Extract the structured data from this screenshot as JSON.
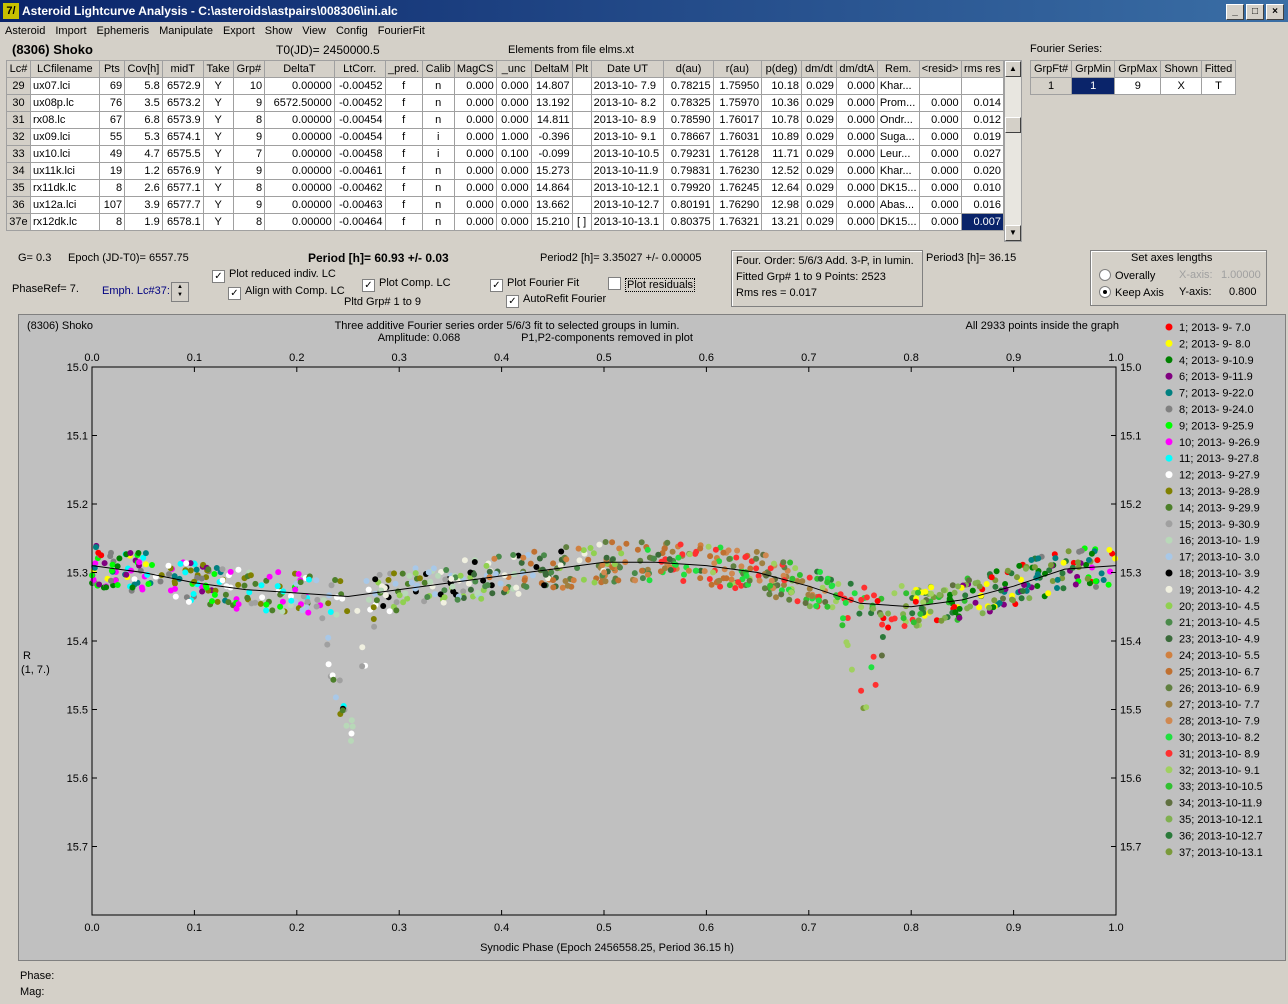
{
  "window": {
    "title": "Asteroid Lightcurve Analysis - C:\\asteroids\\astpairs\\008306\\ini.alc",
    "icon_glyph": "7/",
    "buttons": [
      "_",
      "□",
      "×"
    ]
  },
  "menu": [
    "Asteroid",
    "Import",
    "Ephemeris",
    "Manipulate",
    "Export",
    "Show",
    "View",
    "Config",
    "FourierFit"
  ],
  "header": {
    "asteroid": "(8306) Shoko",
    "t0": "T0(JD)= 2450000.5",
    "elements": "Elements from file elms.xt",
    "fourier_label": "Fourier Series:"
  },
  "lc_table": {
    "columns": [
      "Lc#",
      "LCfilename",
      "Pts",
      "Cov[h]",
      "midT",
      "Take",
      "Grp#",
      "DeltaT",
      "LtCorr.",
      "_pred.",
      "Calib",
      "MagCS",
      "_unc",
      "DeltaM",
      "Plt",
      "Date UT",
      "d(au)",
      "r(au)",
      "p(deg)",
      "dm/dt",
      "dm/dtA",
      "Rem.",
      "<resid>",
      "rms res"
    ],
    "rows": [
      [
        "29",
        "ux07.lci",
        "69",
        "5.8",
        "6572.9",
        "Y",
        "10",
        "0.00000",
        "-0.00452",
        "f",
        "n",
        "0.000",
        "0.000",
        "14.807",
        "",
        "2013-10- 7.9",
        "0.78215",
        "1.75950",
        "10.18",
        "0.029",
        "0.000",
        "Khar...",
        "",
        ""
      ],
      [
        "30",
        "ux08p.lc",
        "76",
        "3.5",
        "6573.2",
        "Y",
        "9",
        "6572.50000",
        "-0.00452",
        "f",
        "n",
        "0.000",
        "0.000",
        "13.192",
        "",
        "2013-10- 8.2",
        "0.78325",
        "1.75970",
        "10.36",
        "0.029",
        "0.000",
        "Prom...",
        "0.000",
        "0.014"
      ],
      [
        "31",
        "rx08.lc",
        "67",
        "6.8",
        "6573.9",
        "Y",
        "8",
        "0.00000",
        "-0.00454",
        "f",
        "n",
        "0.000",
        "0.000",
        "14.811",
        "",
        "2013-10- 8.9",
        "0.78590",
        "1.76017",
        "10.78",
        "0.029",
        "0.000",
        "Ondr...",
        "0.000",
        "0.012"
      ],
      [
        "32",
        "ux09.lci",
        "55",
        "5.3",
        "6574.1",
        "Y",
        "9",
        "0.00000",
        "-0.00454",
        "f",
        "i",
        "0.000",
        "1.000",
        "-0.396",
        "",
        "2013-10- 9.1",
        "0.78667",
        "1.76031",
        "10.89",
        "0.029",
        "0.000",
        "Suga...",
        "0.000",
        "0.019"
      ],
      [
        "33",
        "ux10.lci",
        "49",
        "4.7",
        "6575.5",
        "Y",
        "7",
        "0.00000",
        "-0.00458",
        "f",
        "i",
        "0.000",
        "0.100",
        "-0.099",
        "",
        "2013-10-10.5",
        "0.79231",
        "1.76128",
        "11.71",
        "0.029",
        "0.000",
        "Leur...",
        "0.000",
        "0.027"
      ],
      [
        "34",
        "ux11k.lci",
        "19",
        "1.2",
        "6576.9",
        "Y",
        "9",
        "0.00000",
        "-0.00461",
        "f",
        "n",
        "0.000",
        "0.000",
        "15.273",
        "",
        "2013-10-11.9",
        "0.79831",
        "1.76230",
        "12.52",
        "0.029",
        "0.000",
        "Khar...",
        "0.000",
        "0.020"
      ],
      [
        "35",
        "rx11dk.lc",
        "8",
        "2.6",
        "6577.1",
        "Y",
        "8",
        "0.00000",
        "-0.00462",
        "f",
        "n",
        "0.000",
        "0.000",
        "14.864",
        "",
        "2013-10-12.1",
        "0.79920",
        "1.76245",
        "12.64",
        "0.029",
        "0.000",
        "DK15...",
        "0.000",
        "0.010"
      ],
      [
        "36",
        "ux12a.lci",
        "107",
        "3.9",
        "6577.7",
        "Y",
        "9",
        "0.00000",
        "-0.00463",
        "f",
        "n",
        "0.000",
        "0.000",
        "13.662",
        "",
        "2013-10-12.7",
        "0.80191",
        "1.76290",
        "12.98",
        "0.029",
        "0.000",
        "Abas...",
        "0.000",
        "0.016"
      ],
      [
        "37e",
        "rx12dk.lc",
        "8",
        "1.9",
        "6578.1",
        "Y",
        "8",
        "0.00000",
        "-0.00464",
        "f",
        "n",
        "0.000",
        "0.000",
        "15.210",
        "[ ]",
        "2013-10-13.1",
        "0.80375",
        "1.76321",
        "13.21",
        "0.029",
        "0.000",
        "DK15...",
        "0.000",
        "0.007"
      ]
    ]
  },
  "fourier_table": {
    "columns": [
      "GrpFt#",
      "GrpMin",
      "GrpMax",
      "Shown",
      "Fitted"
    ],
    "row": [
      "1",
      "1",
      "9",
      "X",
      "T"
    ]
  },
  "params": {
    "g": "G= 0.3",
    "epoch": "Epoch (JD-T0)= 6557.75",
    "period": "Period [h]= 60.93 +/- 0.03",
    "period2": "Period2 [h]= 3.35027 +/- 0.00005",
    "period3": "Period3 [h]= 36.15",
    "phaseref": "PhaseRef= 7.",
    "emph": "Emph. Lc#37:",
    "cb_reduced": "Plot reduced indiv. LC",
    "cb_align": "Align with Comp. LC",
    "cb_comp": "Plot Comp. LC",
    "pltd": "Pltd Grp#  1   to   9",
    "cb_fourier": "Plot Fourier Fit",
    "cb_autorefit": "AutoRefit Fourier",
    "cb_residuals": "Plot residuals",
    "four_order": "Four. Order:  5/6/3   Add. 3-P, in lumin.",
    "fitted_grp": "Fitted Grp# 1 to 9     Points: 2523",
    "rms": "Rms res     = 0.017",
    "axes_title": "Set axes lengths",
    "overally": "Overally",
    "keep_axis": "Keep Axis",
    "xaxis_label": "X-axis:",
    "xaxis_val": "1.00000",
    "yaxis_label": "Y-axis:",
    "yaxis_val": "0.800"
  },
  "chart_data": {
    "type": "scatter",
    "title": "Three additive Fourier series order 5/6/3 fit to selected groups in lumin.",
    "subtitle": "Amplitude: 0.068",
    "subtitle2": "P1,P2-components removed in plot",
    "corner_left": "(8306) Shoko",
    "corner_right": "All 2933 points inside the graph",
    "xlabel": "Synodic Phase (Epoch 2456558.25, Period 36.15 h)",
    "ylabel": "R",
    "ylabel2": "(1, 7.)",
    "xlim": [
      0.0,
      1.0
    ],
    "ylim": [
      15.0,
      15.8
    ],
    "y_inverted": true,
    "x_ticks": [
      "0.0",
      "0.1",
      "0.2",
      "0.3",
      "0.4",
      "0.5",
      "0.6",
      "0.7",
      "0.8",
      "0.9",
      "1.0"
    ],
    "y_ticks": [
      "15.0",
      "15.1",
      "15.2",
      "15.3",
      "15.4",
      "15.5",
      "15.6",
      "15.7"
    ],
    "fourier_curve": [
      [
        0.0,
        15.29
      ],
      [
        0.05,
        15.3
      ],
      [
        0.1,
        15.315
      ],
      [
        0.15,
        15.325
      ],
      [
        0.2,
        15.33
      ],
      [
        0.25,
        15.335
      ],
      [
        0.3,
        15.325
      ],
      [
        0.35,
        15.315
      ],
      [
        0.4,
        15.305
      ],
      [
        0.45,
        15.295
      ],
      [
        0.5,
        15.285
      ],
      [
        0.55,
        15.285
      ],
      [
        0.6,
        15.29
      ],
      [
        0.65,
        15.3
      ],
      [
        0.7,
        15.32
      ],
      [
        0.75,
        15.345
      ],
      [
        0.8,
        15.35
      ],
      [
        0.85,
        15.34
      ],
      [
        0.9,
        15.32
      ],
      [
        0.95,
        15.295
      ],
      [
        1.0,
        15.29
      ]
    ],
    "legend": [
      {
        "label": "1; 2013- 9- 7.0",
        "color": "#ff0000"
      },
      {
        "label": "2; 2013- 9- 8.0",
        "color": "#ffff00"
      },
      {
        "label": "4; 2013- 9-10.9",
        "color": "#008000"
      },
      {
        "label": "6; 2013- 9-11.9",
        "color": "#800080"
      },
      {
        "label": "7; 2013- 9-22.0",
        "color": "#008080"
      },
      {
        "label": "8; 2013- 9-24.0",
        "color": "#808080"
      },
      {
        "label": "9; 2013- 9-25.9",
        "color": "#00ff00"
      },
      {
        "label": "10; 2013- 9-26.9",
        "color": "#ff00ff"
      },
      {
        "label": "11; 2013- 9-27.8",
        "color": "#00ffff"
      },
      {
        "label": "12; 2013- 9-27.9",
        "color": "#ffffff"
      },
      {
        "label": "13; 2013- 9-28.9",
        "color": "#808000"
      },
      {
        "label": "14; 2013- 9-29.9",
        "color": "#4c7f2a"
      },
      {
        "label": "15; 2013- 9-30.9",
        "color": "#a0a0a0"
      },
      {
        "label": "16; 2013-10- 1.9",
        "color": "#b8d8b8"
      },
      {
        "label": "17; 2013-10- 3.0",
        "color": "#a8c8e8"
      },
      {
        "label": "18; 2013-10- 3.9",
        "color": "#000000"
      },
      {
        "label": "19; 2013-10- 4.2",
        "color": "#f0f0e0"
      },
      {
        "label": "20; 2013-10- 4.5",
        "color": "#90d050"
      },
      {
        "label": "21; 2013-10- 4.5",
        "color": "#4a8a4a"
      },
      {
        "label": "23; 2013-10- 4.9",
        "color": "#3a6a3a"
      },
      {
        "label": "24; 2013-10- 5.5",
        "color": "#d08040"
      },
      {
        "label": "25; 2013-10- 6.7",
        "color": "#c07030"
      },
      {
        "label": "26; 2013-10- 6.9",
        "color": "#608040"
      },
      {
        "label": "27; 2013-10- 7.7",
        "color": "#a08040"
      },
      {
        "label": "28; 2013-10- 7.9",
        "color": "#d08850"
      },
      {
        "label": "30; 2013-10- 8.2",
        "color": "#20e040"
      },
      {
        "label": "31; 2013-10- 8.9",
        "color": "#ff3030"
      },
      {
        "label": "32; 2013-10- 9.1",
        "color": "#a0d060"
      },
      {
        "label": "33; 2013-10-10.5",
        "color": "#30c030"
      },
      {
        "label": "34; 2013-10-11.9",
        "color": "#607040"
      },
      {
        "label": "35; 2013-10-12.1",
        "color": "#80b050"
      },
      {
        "label": "36; 2013-10-12.7",
        "color": "#2a7a3a"
      },
      {
        "label": "37; 2013-10-13.1",
        "color": "#7a9a3a"
      }
    ]
  },
  "status": {
    "phase": "Phase:",
    "mag": "Mag:"
  }
}
